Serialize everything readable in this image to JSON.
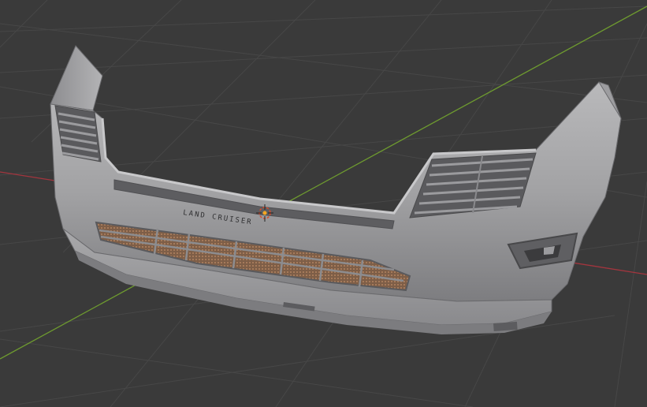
{
  "viewport": {
    "background_color": "#3a3a3a",
    "grid_color": "#454545",
    "x_axis_color": "#a3353e",
    "y_axis_color": "#6e9b2f"
  },
  "model": {
    "badge_text": "LAND CRUISER",
    "surface_color": "#a3a3a5",
    "grille_mesh_color": "#8f6a4f"
  },
  "origin": {
    "icon": "object-origin-icon",
    "cursor_icon": "3d-cursor-icon"
  }
}
